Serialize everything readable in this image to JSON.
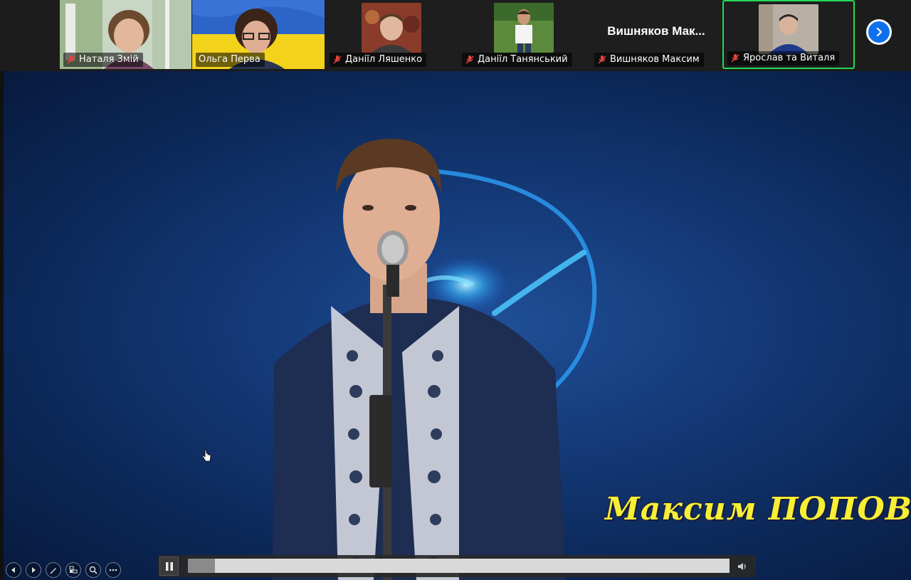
{
  "participants": [
    {
      "name": "Наталя Змій",
      "muted": true,
      "video": "photo-woman-window"
    },
    {
      "name": "Ольга Перва",
      "muted": false,
      "video": "photo-woman-flag"
    },
    {
      "name": "Даніїл Ляшенко",
      "muted": true,
      "video": "photo-young-man-carpet"
    },
    {
      "name": "Даніїл Танянський",
      "muted": true,
      "video": "photo-young-man-outdoor"
    },
    {
      "name": "Вишняков Максим",
      "muted": true,
      "video": "none",
      "display_name": "Вишняков  Мак..."
    },
    {
      "name": "Ярослав та Виталя",
      "muted": true,
      "video": "photo-young-man-room",
      "active_speaker": true
    }
  ],
  "strip_next_icon": "chevron-right-icon",
  "main_video": {
    "caption": "Максим ПОПОВ",
    "caption_color": "#f6ef36",
    "background_color": "#143a78"
  },
  "slideshow_tools": [
    "previous-icon",
    "next-icon",
    "pen-icon",
    "slides-icon",
    "zoom-icon",
    "more-icon"
  ],
  "media": {
    "state_icon": "pause-icon",
    "progress": 0.05,
    "volume_icon": "speaker-icon"
  },
  "colors": {
    "active_border": "#23d959",
    "next_button": "#0e71eb",
    "muted_icon": "#e5443f"
  }
}
